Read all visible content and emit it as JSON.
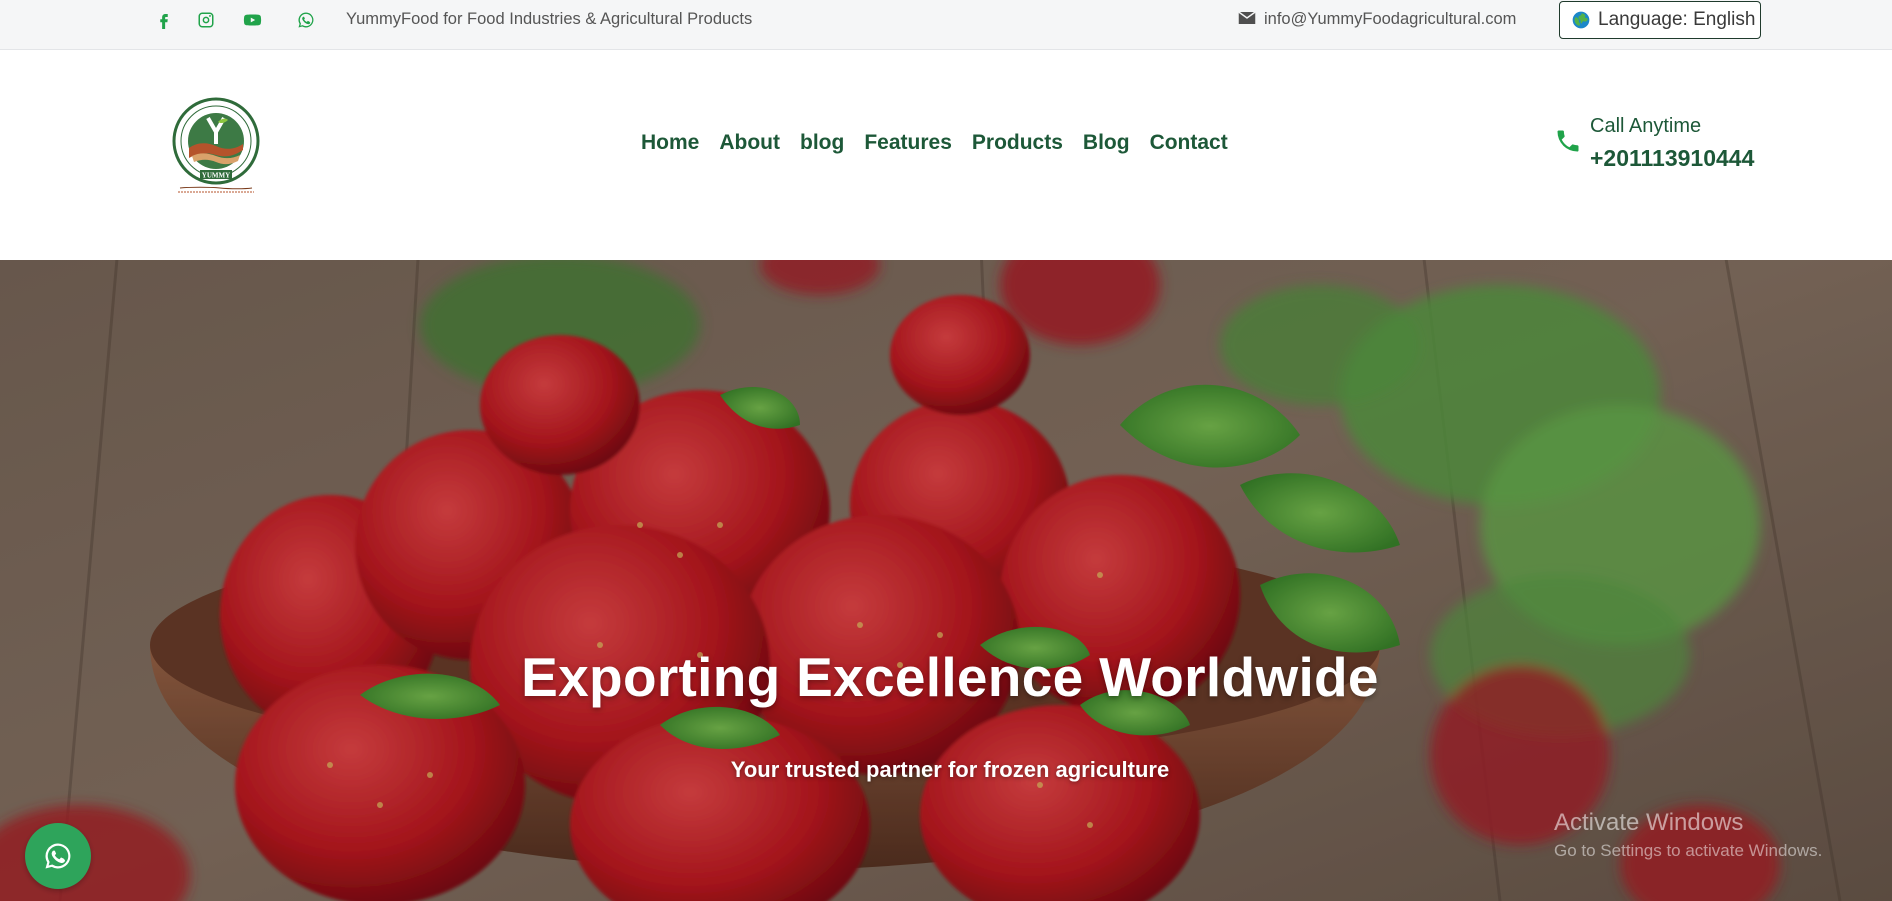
{
  "topbar": {
    "social_icons": [
      "facebook-icon",
      "instagram-icon",
      "youtube-icon",
      "whatsapp-icon"
    ],
    "tagline": "YummyFood for Food Industries & Agricultural Products",
    "email": "info@YummyFoodagricultural.com",
    "language_label": "Language: English"
  },
  "header": {
    "logo_text": "YUMMY",
    "nav": [
      "Home",
      "About",
      "blog",
      "Features",
      "Products",
      "Blog",
      "Contact"
    ],
    "call_label": "Call Anytime",
    "call_number": "+201113910444"
  },
  "hero": {
    "title": "Exporting Excellence Worldwide",
    "subtitle": "Your trusted partner for frozen agriculture"
  },
  "os_watermark": {
    "line1": "Activate Windows",
    "line2": "Go to Settings to activate Windows."
  },
  "colors": {
    "accent_green": "#20a34a",
    "nav_green": "#1d5838",
    "topbar_bg": "#f5f6f7",
    "whatsapp_button": "#2ea45b"
  }
}
